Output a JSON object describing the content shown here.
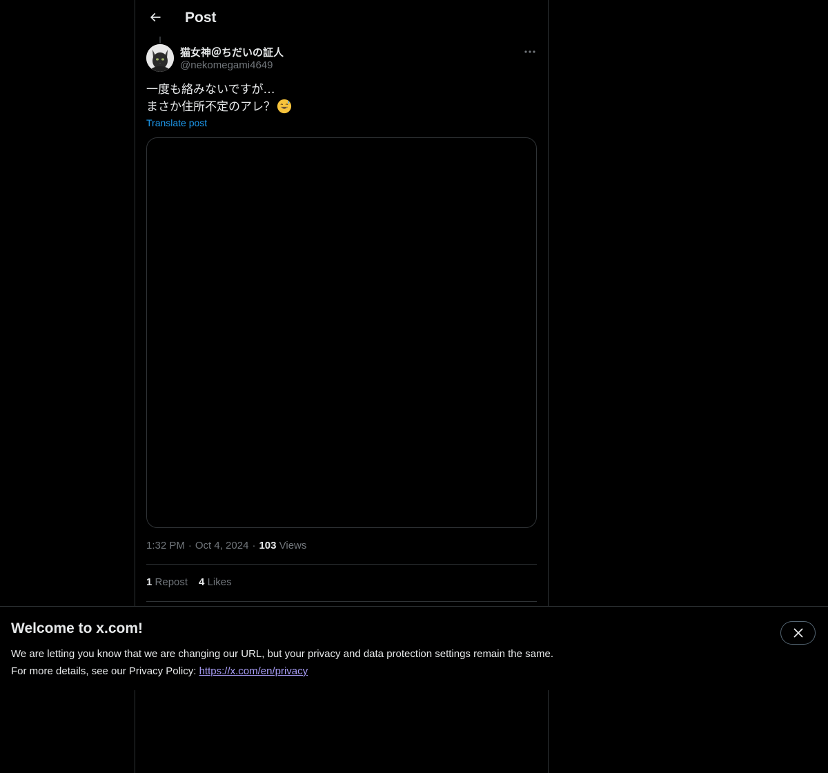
{
  "header": {
    "title": "Post",
    "back_icon": "arrow-left-icon"
  },
  "post": {
    "author": {
      "display_name": "猫女神＠ちだいの証人",
      "handle": "@nekomegami4649",
      "avatar_icon": "cat-avatar"
    },
    "text_line1": "一度も絡みないですが…",
    "text_line2": "まさか住所不定のアレ？",
    "emoji": "grinning-sweat-emoji",
    "translate_label": "Translate post",
    "time": "1:32 PM",
    "date": "Oct 4, 2024",
    "views_count": "103",
    "views_label": "Views",
    "reposts_count": "1",
    "reposts_label": "Repost",
    "likes_count": "4",
    "likes_label": "Likes"
  },
  "banner": {
    "title": "Welcome to x.com!",
    "line1": "We are letting you know that we are changing our URL, but your privacy and data protection settings remain the same.",
    "line2_prefix": "For more details, see our Privacy Policy: ",
    "link_text": "https://x.com/en/privacy",
    "close_icon": "close-icon"
  },
  "colors": {
    "background": "#000000",
    "text": "#e7e9ea",
    "muted": "#71767b",
    "accent": "#1d9bf0",
    "border": "#2f3336",
    "link": "#a79cf5"
  }
}
